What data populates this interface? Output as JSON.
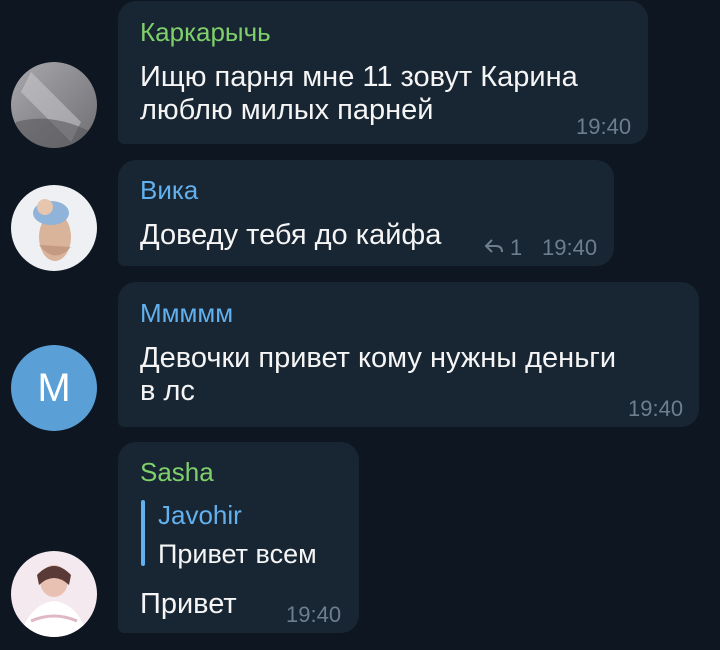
{
  "colors": {
    "background": "#0e1621",
    "bubble": "#182533",
    "name_green": "#7fd06b",
    "name_blue": "#62b1ee",
    "time": "#6d7f8f",
    "avatar_m": "#5a9fd6"
  },
  "messages": [
    {
      "sender": "Каркарычь",
      "text": "Ищю парня мне 11 зовут Карина\nлюблю милых парней",
      "time": "19:40",
      "avatar_type": "photo"
    },
    {
      "sender": "Вика",
      "text": "Доведу тебя до кайфа",
      "time": "19:40",
      "reply_count": "1",
      "avatar_type": "photo"
    },
    {
      "sender": "Ммммм",
      "text": "Девочки привет кому нужны деньги\nв лс",
      "time": "19:40",
      "avatar_letter": "М"
    },
    {
      "sender": "Sasha",
      "quote_author": "Javohir",
      "quote_text": "Привет всем",
      "text": "Привет",
      "time": "19:40",
      "avatar_type": "photo"
    }
  ]
}
